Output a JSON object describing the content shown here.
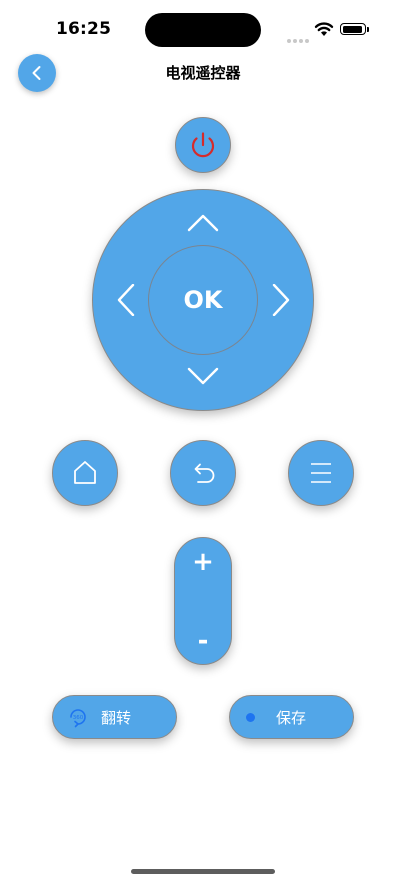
{
  "status_bar": {
    "time": "16:25"
  },
  "nav": {
    "title": "电视遥控器",
    "back_icon": "chevron-left-icon"
  },
  "remote": {
    "power_icon": "power-icon",
    "power_color": "#d62b2b",
    "ok_label": "OK",
    "volume_up_label": "+",
    "volume_down_label": "-",
    "flip_label": "翻转",
    "save_label": "保存",
    "accent_color": "#52a6e8"
  }
}
